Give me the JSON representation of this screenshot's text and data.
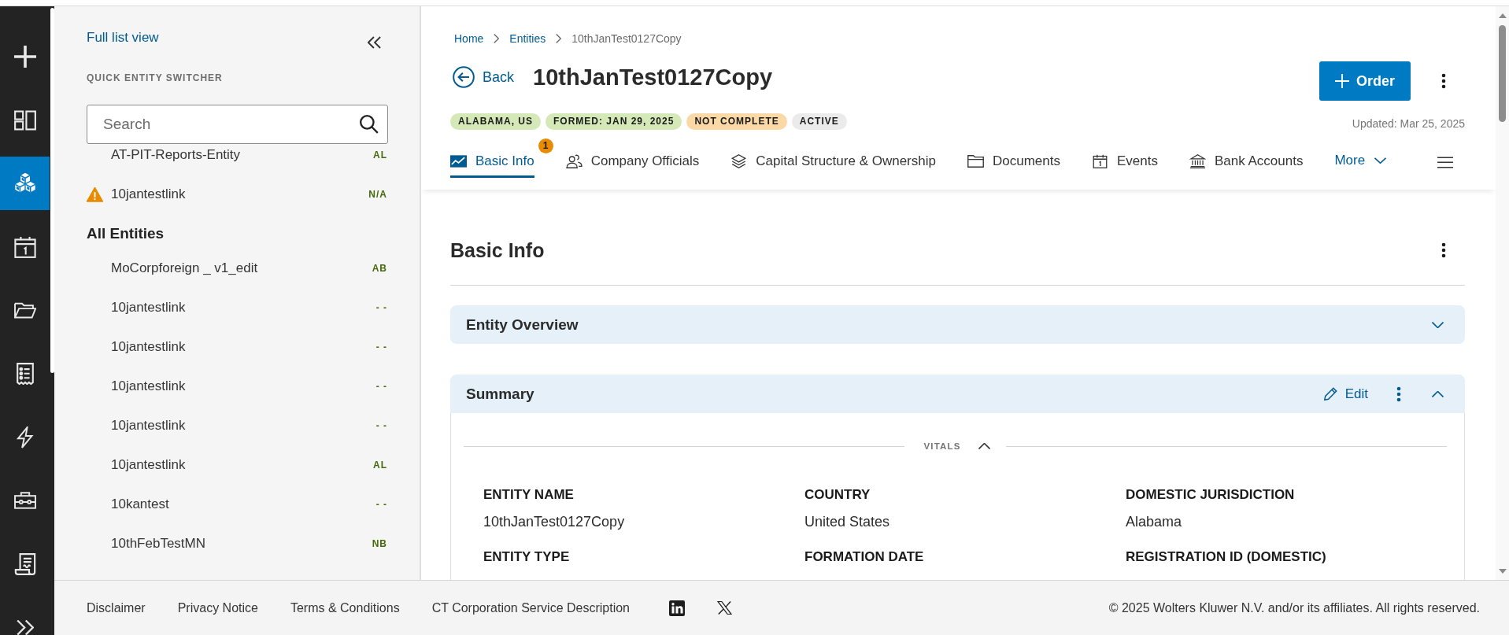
{
  "rail": {
    "items": [
      {
        "selected": false
      },
      {
        "selected": false
      },
      {
        "selected": true
      },
      {
        "selected": false
      },
      {
        "selected": false
      },
      {
        "selected": false
      },
      {
        "selected": false
      },
      {
        "selected": false
      },
      {
        "selected": false
      }
    ]
  },
  "sidebar": {
    "full_list_link": "Full list view",
    "section_title": "QUICK ENTITY SWITCHER",
    "search": {
      "placeholder": "Search"
    },
    "recent": [
      {
        "name": "AT-PIT-Reports-Entity",
        "code": "AL",
        "warning": false
      },
      {
        "name": "10jantestlink",
        "code": "N/A",
        "warning": true
      }
    ],
    "all_heading": "All Entities",
    "entities": [
      {
        "name": "MoCorpforeign _ v1_edit",
        "code": "AB",
        "warning": false
      },
      {
        "name": "10jantestlink",
        "code": "- -",
        "warning": false
      },
      {
        "name": "10jantestlink",
        "code": "- -",
        "warning": false
      },
      {
        "name": "10jantestlink",
        "code": "- -",
        "warning": false
      },
      {
        "name": "10jantestlink",
        "code": "- -",
        "warning": false
      },
      {
        "name": "10jantestlink",
        "code": "AL",
        "warning": false
      },
      {
        "name": "10kantest",
        "code": "- -",
        "warning": false
      },
      {
        "name": "10thFebTestMN",
        "code": "NB",
        "warning": false
      }
    ]
  },
  "header": {
    "breadcrumb": [
      {
        "label": "Home",
        "current": false
      },
      {
        "label": "Entities",
        "current": false
      },
      {
        "label": "10thJanTest0127Copy",
        "current": true
      }
    ],
    "back": "Back",
    "title": "10thJanTest0127Copy",
    "order_button": "Order",
    "tags": [
      {
        "label": "ALABAMA, US",
        "color": "#d5e8b8"
      },
      {
        "label": "FORMED: JAN 29, 2025",
        "color": "#d5e8b8"
      },
      {
        "label": "NOT COMPLETE",
        "color": "#fad9a6"
      },
      {
        "label": "ACTIVE",
        "color": "#ebebeb"
      }
    ],
    "updated": "Updated: Mar 25, 2025",
    "tabs": [
      {
        "label": "Basic Info",
        "selected": true,
        "badge": "1"
      },
      {
        "label": "Company Officials",
        "selected": false
      },
      {
        "label": "Capital Structure & Ownership",
        "selected": false
      },
      {
        "label": "Documents",
        "selected": false
      },
      {
        "label": "Events",
        "selected": false
      },
      {
        "label": "Bank Accounts",
        "selected": false
      }
    ],
    "more": "More"
  },
  "content": {
    "title": "Basic Info",
    "sections": [
      {
        "title": "Entity Overview",
        "expanded": false
      },
      {
        "title": "Summary",
        "expanded": true,
        "edit": "Edit",
        "group": {
          "title": "VITALS",
          "expanded": true,
          "fields": [
            {
              "label": "ENTITY NAME",
              "value": "10thJanTest0127Copy"
            },
            {
              "label": "COUNTRY",
              "value": "United States"
            },
            {
              "label": "DOMESTIC JURISDICTION",
              "value": "Alabama"
            },
            {
              "label": "ENTITY TYPE"
            },
            {
              "label": "FORMATION DATE"
            },
            {
              "label": "REGISTRATION ID (DOMESTIC)"
            }
          ]
        }
      }
    ]
  },
  "footer": {
    "links": [
      "Disclaimer",
      "Privacy Notice",
      "Terms & Conditions",
      "CT Corporation Service Description"
    ],
    "copyright": "© 2025 Wolters Kluwer N.V. and/or its affiliates. All rights reserved."
  }
}
